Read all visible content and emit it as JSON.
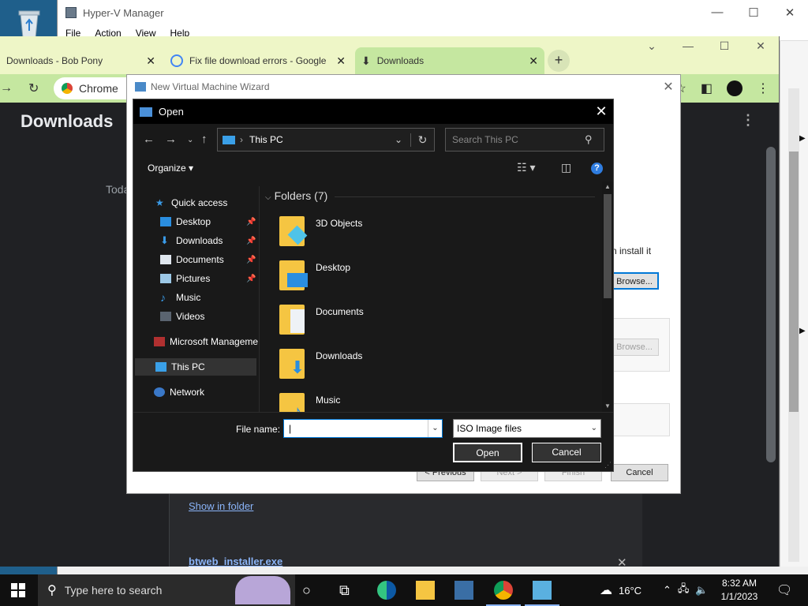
{
  "hyperv": {
    "title": "Hyper-V Manager",
    "menu": [
      "File",
      "Action",
      "View",
      "Help"
    ]
  },
  "chrome": {
    "tabs": [
      {
        "label": "Downloads - Bob Pony"
      },
      {
        "label": "Fix file download errors - Google"
      },
      {
        "label": "Downloads"
      }
    ],
    "omnibox_label": "Chrome",
    "page_title": "Downloads",
    "section_label": "Toda",
    "show_in_folder": "Show in folder",
    "download_file": "btweb_installer.exe"
  },
  "wizard": {
    "title": "New Virtual Machine Wizard",
    "text_fragment": "n install it",
    "browse_label": "Browse...",
    "browse2_label": "Browse...",
    "previous_label": "< Previous",
    "next_label": "Next >",
    "finish_label": "Finish",
    "cancel_label": "Cancel"
  },
  "open_dialog": {
    "title": "Open",
    "address": "This PC",
    "search_placeholder": "Search This PC",
    "organize_label": "Organize",
    "nav": {
      "quick_access": "Quick access",
      "desktop": "Desktop",
      "downloads": "Downloads",
      "documents": "Documents",
      "pictures": "Pictures",
      "music": "Music",
      "videos": "Videos",
      "microsoft": "Microsoft Manageme",
      "this_pc": "This PC",
      "network": "Network"
    },
    "group_label": "Folders (7)",
    "folders": [
      "3D Objects",
      "Desktop",
      "Documents",
      "Downloads",
      "Music"
    ],
    "file_name_label": "File name:",
    "file_name_value": "",
    "file_type": "ISO Image files",
    "open_label": "Open",
    "cancel_label": "Cancel"
  },
  "taskbar": {
    "search_placeholder": "Type here to search",
    "weather": "16°C",
    "time": "8:32 AM",
    "date": "1/1/2023"
  },
  "colors": {
    "accent": "#0078d7",
    "chrome_tab_active": "#c5e7a0",
    "folder": "#f5c542"
  }
}
